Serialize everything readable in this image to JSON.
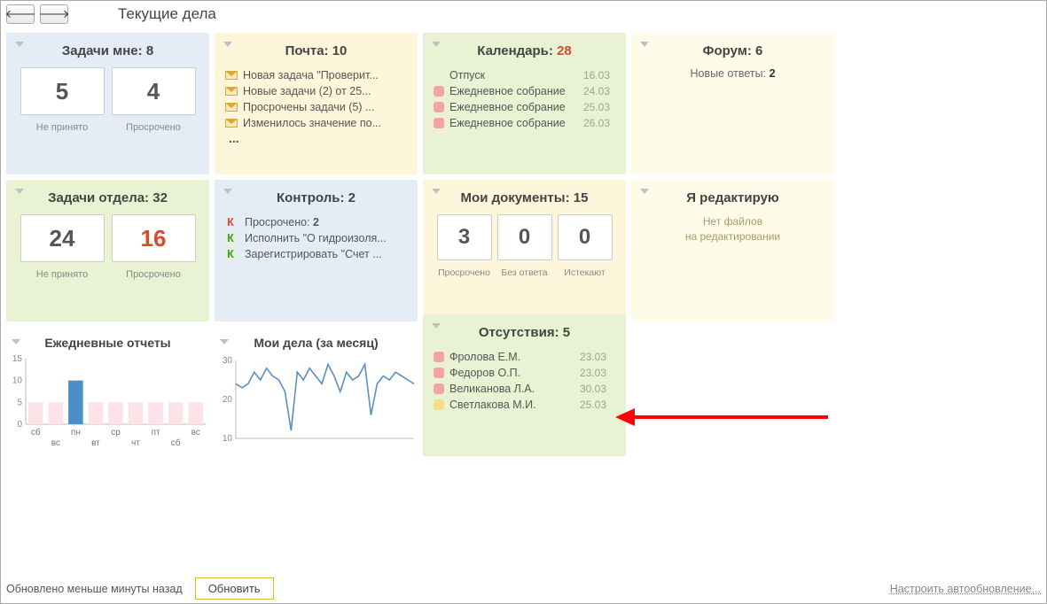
{
  "nav": {
    "back": "🡐",
    "forward": "🡒"
  },
  "title": "Текущие дела",
  "tasks_me": {
    "title": "Задачи мне:",
    "count": "8",
    "box1": "5",
    "box2": "4",
    "cap1": "Не принято",
    "cap2": "Просрочено"
  },
  "mail": {
    "title": "Почта:",
    "count": "10",
    "items": [
      "Новая задача \"Проверит...",
      "Новые задачи (2) от 25...",
      "Просрочены задачи (5) ...",
      "Изменилось значение по..."
    ],
    "more": "..."
  },
  "calendar": {
    "title": "Календарь:",
    "count": "28",
    "items": [
      {
        "label": "Отпуск",
        "date": "16.03",
        "sq": ""
      },
      {
        "label": "Ежедневное собрание",
        "date": "24.03",
        "sq": "pink"
      },
      {
        "label": "Ежедневное собрание",
        "date": "25.03",
        "sq": "pink"
      },
      {
        "label": "Ежедневное собрание",
        "date": "26.03",
        "sq": "pink"
      }
    ]
  },
  "forum": {
    "title": "Форум:",
    "count": "6",
    "line_label": "Новые ответы:",
    "line_value": "2"
  },
  "tasks_dept": {
    "title": "Задачи отдела:",
    "count": "32",
    "box1": "24",
    "box2": "16",
    "cap1": "Не принято",
    "cap2": "Просрочено"
  },
  "control": {
    "title": "Контроль:",
    "count": "2",
    "items": [
      {
        "k": "К",
        "cls": "red",
        "text": "Просрочено: ",
        "bold": "2"
      },
      {
        "k": "К",
        "cls": "green",
        "text": "Исполнить \"О гидроизоля..."
      },
      {
        "k": "К",
        "cls": "green",
        "text": "Зарегистрировать \"Счет ..."
      }
    ]
  },
  "mydocs": {
    "title": "Мои документы:",
    "count": "15",
    "b1": "3",
    "b2": "0",
    "b3": "0",
    "c1": "Просрочено",
    "c2": "Без ответа",
    "c3": "Истекают"
  },
  "editing": {
    "title": "Я редактирую",
    "line1": "Нет файлов",
    "line2": "на редактировании"
  },
  "absences": {
    "title": "Отсутствия:",
    "count": "5",
    "items": [
      {
        "sq": "pink",
        "name": "Фролова Е.М.",
        "date": "23.03"
      },
      {
        "sq": "pink",
        "name": "Федоров О.П.",
        "date": "23.03"
      },
      {
        "sq": "pink",
        "name": "Великанова Л.А.",
        "date": "30.03"
      },
      {
        "sq": "yel",
        "name": "Светлакова М.И.",
        "date": "25.03"
      }
    ]
  },
  "daily": {
    "title": "Ежедневные отчеты"
  },
  "mydeals": {
    "title": "Мои дела (за месяц)"
  },
  "chart_data": [
    {
      "type": "bar",
      "title": "Ежедневные отчеты",
      "categories": [
        "сб",
        "вс",
        "пн",
        "вт",
        "ср",
        "чт",
        "пт",
        "сб",
        "вс"
      ],
      "values": [
        5,
        5,
        10,
        5,
        5,
        5,
        5,
        5,
        5
      ],
      "highlight_index": 2,
      "ylim": [
        0,
        15
      ],
      "yticks": [
        0,
        5,
        10,
        15
      ]
    },
    {
      "type": "line",
      "title": "Мои дела (за месяц)",
      "x": [
        1,
        2,
        3,
        4,
        5,
        6,
        7,
        8,
        9,
        10,
        11,
        12,
        13,
        14,
        15,
        16,
        17,
        18,
        19,
        20,
        21,
        22,
        23,
        24,
        25,
        26,
        27,
        28,
        29,
        30
      ],
      "values": [
        24,
        23,
        24,
        27,
        25,
        28,
        26,
        25,
        22,
        12,
        27,
        25,
        28,
        26,
        24,
        29,
        26,
        22,
        27,
        25,
        26,
        29,
        16,
        24,
        26,
        25,
        27,
        26,
        25,
        24
      ],
      "ylim": [
        10,
        30
      ],
      "yticks": [
        10,
        20,
        30
      ]
    }
  ],
  "footer": {
    "status": "Обновлено меньше минуты назад",
    "refresh": "Обновить",
    "settings": "Настроить автообновление..."
  }
}
